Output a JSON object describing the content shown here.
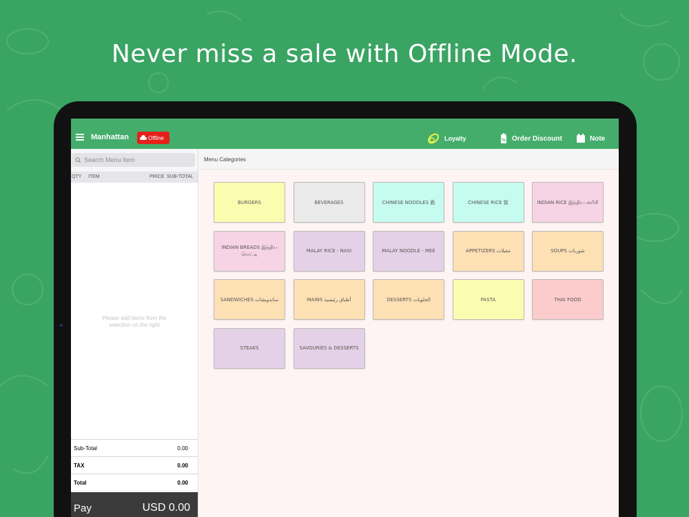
{
  "headline": "Never miss a sale with Offline Mode.",
  "topbar": {
    "store_name": "Manhattan",
    "offline_label": "Offline",
    "loyalty_label": "Loyalty",
    "discount_label": "Order Discount",
    "note_label": "Note"
  },
  "order": {
    "search_placeholder": "Search Menu Item",
    "columns": {
      "qty": "QTY",
      "item": "ITEM",
      "price": "PRICE",
      "subtotal": "SUB-TOTAL"
    },
    "empty_message": "Please add items from the selection on the right",
    "subtotal_label": "Sub-Total",
    "subtotal_value": "0.00",
    "tax_label": "TAX",
    "tax_value": "0.00",
    "total_label": "Total",
    "total_value": "0.00",
    "pay_label": "Pay",
    "pay_amount": "USD 0.00"
  },
  "menu": {
    "header": "Menu Categories",
    "categories": [
      {
        "label": "BURGERS",
        "color": "#fafdb0"
      },
      {
        "label": "BEVERAGES",
        "color": "#eaeaea"
      },
      {
        "label": "CHINESE NOODLES 面",
        "color": "#c6fbf0"
      },
      {
        "label": "CHINESE RICE 饭",
        "color": "#c6fbf0"
      },
      {
        "label": "INDIAN RICE  இந்திய அரிசி",
        "color": "#f7d4e5"
      },
      {
        "label": "INDIAN BREADS இந்திய ரொட்டி",
        "color": "#f7d4e5"
      },
      {
        "label": "MALAY RICE - NASI",
        "color": "#e5d1e7"
      },
      {
        "label": "MALAY NOODLE - MEE",
        "color": "#e5d1e7"
      },
      {
        "label": "APPETIZERS مقبلات",
        "color": "#fde0b4"
      },
      {
        "label": "SOUPS شوربات",
        "color": "#fde0b4"
      },
      {
        "label": "SANDWICHES ساندويشات",
        "color": "#fde0b4"
      },
      {
        "label": "MAINS أطباق رئيسية",
        "color": "#fde0b4"
      },
      {
        "label": "DESSERTS الحلويات",
        "color": "#fde0b4"
      },
      {
        "label": "PASTA",
        "color": "#fafdb0"
      },
      {
        "label": "THAI FOOD",
        "color": "#fccbcb"
      },
      {
        "label": "STEAKS",
        "color": "#e5d1e7"
      },
      {
        "label": "SAVOURIES & DESSERTS",
        "color": "#e5d1e7"
      }
    ]
  },
  "colors": {
    "background": "#3aa463",
    "topbar": "#45ad6b",
    "offline_badge": "#e5201b",
    "pay_bar": "#3b3b3b"
  }
}
